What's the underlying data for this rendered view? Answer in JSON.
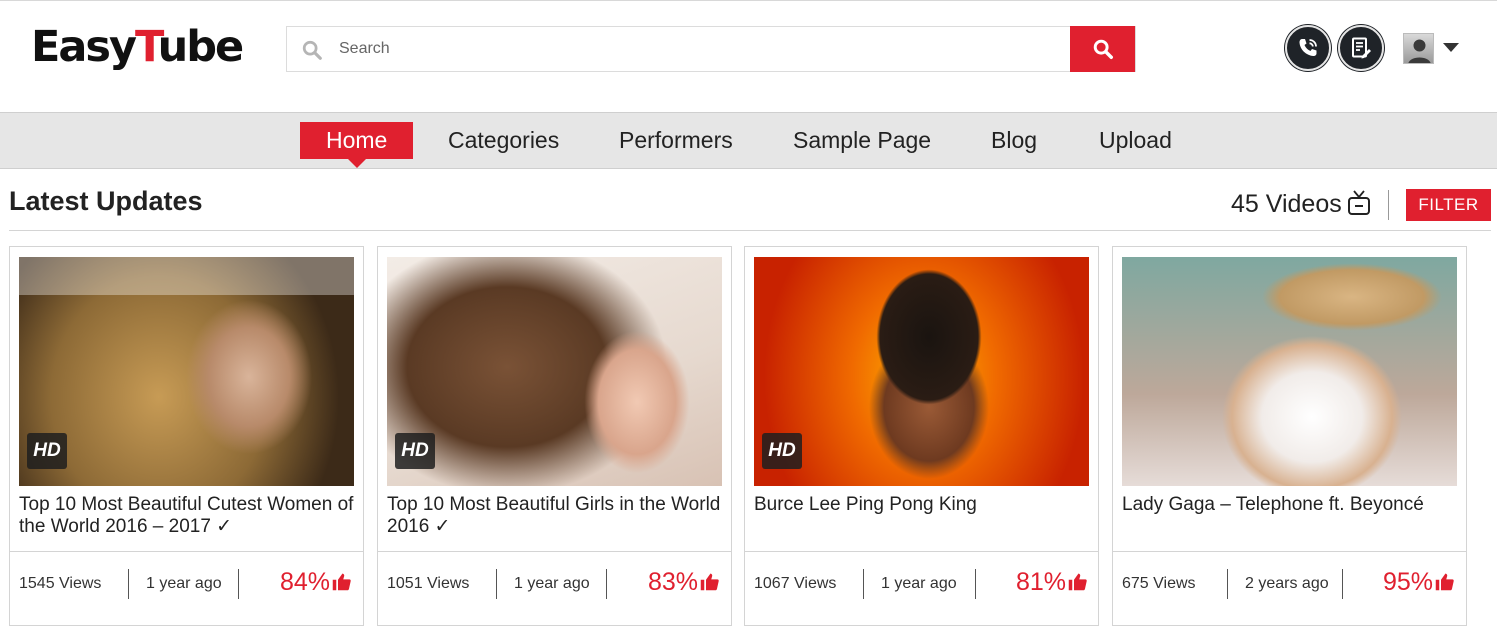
{
  "header": {
    "logo_prefix": "Easy",
    "logo_accent": "T",
    "logo_suffix": "ube",
    "search_placeholder": "Search",
    "icons": [
      "search-icon",
      "phone-call-icon",
      "document-icon",
      "user-avatar-icon",
      "chevron-down-icon"
    ]
  },
  "nav": {
    "items": [
      {
        "label": "Home",
        "active": true
      },
      {
        "label": "Categories"
      },
      {
        "label": "Performers"
      },
      {
        "label": "Sample Page"
      },
      {
        "label": "Blog"
      },
      {
        "label": "Upload"
      }
    ]
  },
  "section": {
    "title": "Latest Updates",
    "video_count": "45 Videos",
    "filter_label": "FILTER"
  },
  "videos": [
    {
      "title": "Top 10 Most Beautiful Cutest Women of the World 2016 – 2017 ✓",
      "hd": "HD",
      "views": "1545 Views",
      "ago": "1 year ago",
      "rating": "84%"
    },
    {
      "title": "Top 10 Most Beautiful Girls in the World 2016 ✓",
      "hd": "HD",
      "views": "1051 Views",
      "ago": "1 year ago",
      "rating": "83%"
    },
    {
      "title": "Burce Lee Ping Pong King",
      "hd": "HD",
      "views": "1067 Views",
      "ago": "1 year ago",
      "rating": "81%"
    },
    {
      "title": "Lady Gaga – Telephone ft. Beyoncé",
      "hd": "",
      "views": "675 Views",
      "ago": "2 years ago",
      "rating": "95%"
    }
  ],
  "colors": {
    "accent": "#e0202f",
    "nav_bg": "#e6e6e6",
    "icon_dark": "#1f2328"
  }
}
